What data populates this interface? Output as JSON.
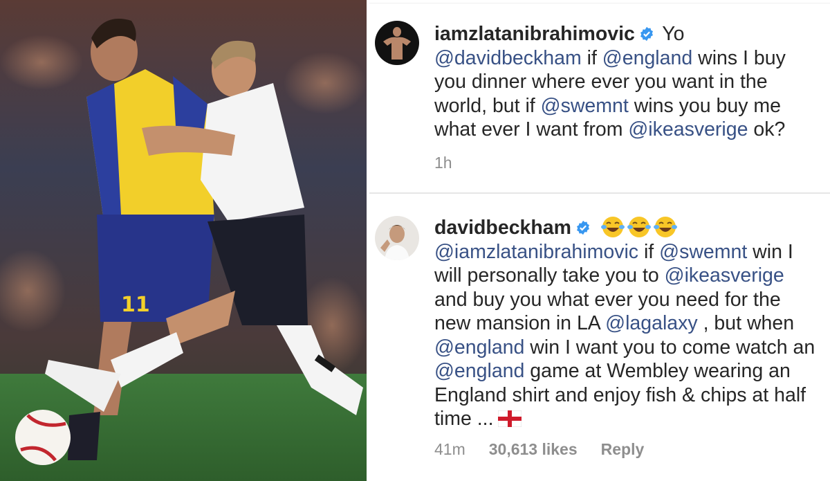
{
  "photo": {
    "alt_name": "match-photo",
    "shirt_number": "11"
  },
  "comments": [
    {
      "username": "iamzlatanibrahimovic",
      "segments": [
        {
          "t": " Yo",
          "m": false
        },
        {
          "t": " @davidbeckham",
          "m": true
        },
        {
          "t": " if",
          "m": false
        },
        {
          "t": " @england",
          "m": true
        },
        {
          "t": " wins I buy you dinner where ever you want in the world, but if",
          "m": false
        },
        {
          "t": " @swemnt",
          "m": true
        },
        {
          "t": " wins you buy me what ever I want from",
          "m": false
        },
        {
          "t": " @ikeasverige",
          "m": true
        },
        {
          "t": " ok?",
          "m": false
        }
      ],
      "time": "1h"
    },
    {
      "username": "davidbeckham",
      "emoji_count": 3,
      "segments": [
        {
          "t": "@iamzlatanibrahimovic",
          "m": true
        },
        {
          "t": " if",
          "m": false
        },
        {
          "t": " @swemnt",
          "m": true
        },
        {
          "t": " win I will personally take you to",
          "m": false
        },
        {
          "t": " @ikeasverige",
          "m": true
        },
        {
          "t": " and buy you what ever you need for the new mansion in LA",
          "m": false
        },
        {
          "t": " @lagalaxy",
          "m": true
        },
        {
          "t": " , but when",
          "m": false
        },
        {
          "t": " @england",
          "m": true
        },
        {
          "t": " win I want you to come watch an",
          "m": false
        },
        {
          "t": " @england",
          "m": true
        },
        {
          "t": " game at Wembley wearing an England shirt and enjoy fish & chips at half time ...",
          "m": false
        }
      ],
      "time": "41m",
      "likes": "30,613 likes",
      "reply": "Reply"
    }
  ],
  "colors": {
    "mention": "#385185",
    "text": "#262626",
    "meta": "#8e8e8e",
    "verified": "#3897f0"
  }
}
